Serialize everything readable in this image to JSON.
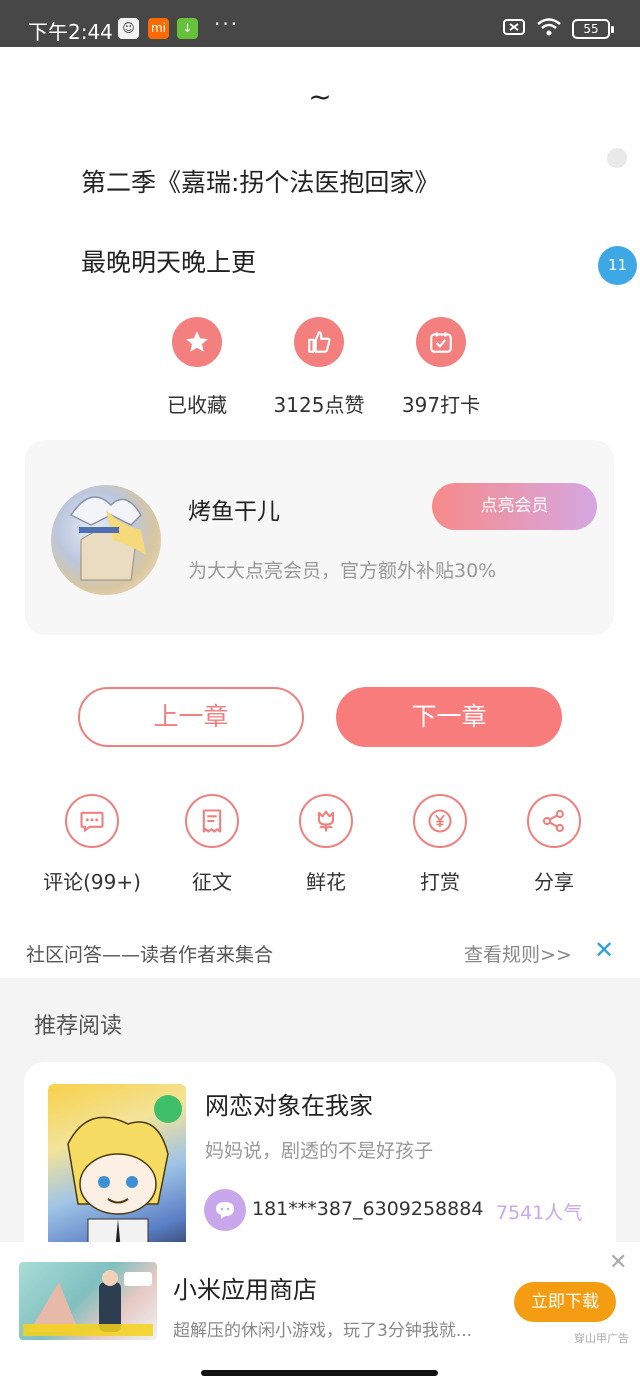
{
  "status_bar": {
    "time": "下午2:44",
    "apps": [
      "chat-app-icon",
      "mi-app-icon",
      "download-app-icon"
    ],
    "dots": "···",
    "battery": "55"
  },
  "content": {
    "tilde": "~",
    "line1": "第二季《嘉瑞:拐个法医抱回家》",
    "line2": "最晚明天晚上更",
    "comment_badge": "11"
  },
  "actions": [
    {
      "label": "已收藏",
      "icon": "star-icon"
    },
    {
      "label": "3125点赞",
      "icon": "thumb-up-icon"
    },
    {
      "label": "397打卡",
      "icon": "calendar-check-icon"
    }
  ],
  "member_card": {
    "name": "烤鱼干儿",
    "desc": "为大大点亮会员，官方额外补贴30%",
    "button": "点亮会员"
  },
  "chapter_nav": {
    "prev": "上一章",
    "next": "下一章"
  },
  "tools": [
    {
      "label": "评论(99+)",
      "icon": "comment-icon"
    },
    {
      "label": "征文",
      "icon": "receipt-icon"
    },
    {
      "label": "鲜花",
      "icon": "flower-icon"
    },
    {
      "label": "打赏",
      "icon": "yen-icon"
    },
    {
      "label": "分享",
      "icon": "share-icon"
    }
  ],
  "community": {
    "text": "社区问答——读者作者来集合",
    "rules": "查看规则>>",
    "close": "✕"
  },
  "recommend": {
    "title": "推荐阅读",
    "book": {
      "name": "网恋对象在我家",
      "desc": "妈妈说，剧透的不是好孩子",
      "author": "181***387_6309258884",
      "popularity": "7541人气"
    }
  },
  "ad": {
    "title": "小米应用商店",
    "desc": "超解压的休闲小游戏，玩了3分钟我就...",
    "button": "立即下载",
    "close": "✕",
    "source": "穿山甲广告"
  },
  "colors": {
    "accent": "#f87c7c",
    "blue": "#3ea7e6",
    "purple": "#c9a7ec",
    "orange": "#f59d12"
  }
}
